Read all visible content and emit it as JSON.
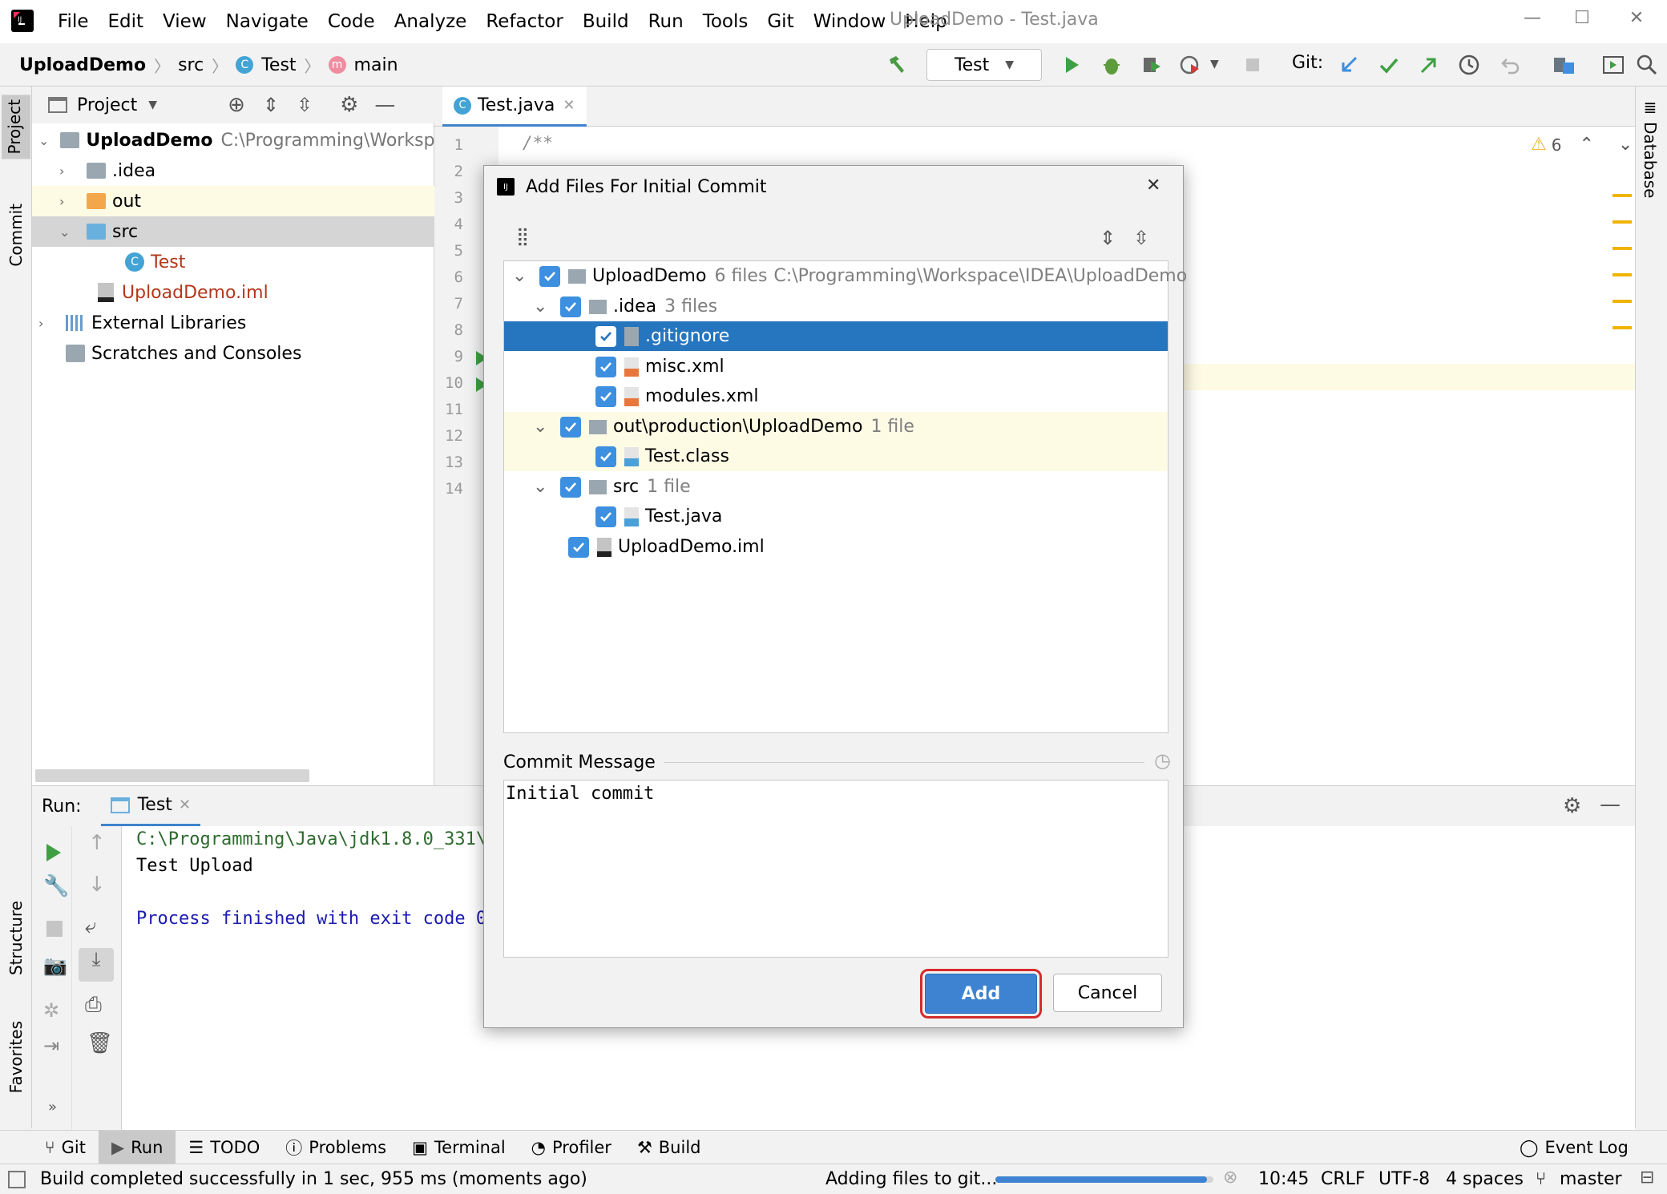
{
  "menu": {
    "items": [
      "File",
      "Edit",
      "View",
      "Navigate",
      "Code",
      "Analyze",
      "Refactor",
      "Build",
      "Run",
      "Tools",
      "Git",
      "Window",
      "Help"
    ],
    "window_title": "UploadDemo - Test.java"
  },
  "navbar": {
    "breadcrumb": [
      "UploadDemo",
      "src",
      "Test",
      "main"
    ],
    "run_config": "Test",
    "git_label": "Git:"
  },
  "left_stripe": {
    "project": "Project",
    "commit": "Commit",
    "structure": "Structure",
    "favorites": "Favorites"
  },
  "right_stripe": {
    "database": "Database"
  },
  "project_panel": {
    "title": "Project",
    "tree": [
      {
        "label": "UploadDemo",
        "extra": "C:\\Programming\\Workspace"
      },
      {
        "label": ".idea"
      },
      {
        "label": "out"
      },
      {
        "label": "src"
      },
      {
        "label": "Test"
      },
      {
        "label": "UploadDemo.iml"
      },
      {
        "label": "External Libraries"
      },
      {
        "label": "Scratches and Consoles"
      }
    ]
  },
  "editor": {
    "tab": "Test.java",
    "line_numbers": [
      "1",
      "2",
      "3",
      "4",
      "5",
      "6",
      "7",
      "8",
      "9",
      "10",
      "11",
      "12",
      "13",
      "14"
    ],
    "code_line1": "/**",
    "warnings": "6"
  },
  "run_panel": {
    "label": "Run:",
    "tab": "Test",
    "console": {
      "cmd": "C:\\Programming\\Java\\jdk1.8.0_331\\",
      "output": "Test Upload",
      "exit": "Process finished with exit code 0"
    }
  },
  "dialog": {
    "title": "Add Files For Initial Commit",
    "files": [
      {
        "name": "UploadDemo",
        "count": "6 files",
        "path": "C:\\Programming\\Workspace\\IDEA\\UploadDemo"
      },
      {
        "name": ".idea",
        "count": "3 files"
      },
      {
        "name": ".gitignore"
      },
      {
        "name": "misc.xml"
      },
      {
        "name": "modules.xml"
      },
      {
        "name": "out\\production\\UploadDemo",
        "count": "1 file"
      },
      {
        "name": "Test.class"
      },
      {
        "name": "src",
        "count": "1 file"
      },
      {
        "name": "Test.java"
      },
      {
        "name": "UploadDemo.iml"
      }
    ],
    "commit_label": "Commit Message",
    "commit_message": "Initial commit",
    "add_button": "Add",
    "cancel_button": "Cancel"
  },
  "bottom_tabs": [
    "Git",
    "Run",
    "TODO",
    "Problems",
    "Terminal",
    "Profiler",
    "Build"
  ],
  "event_log": "Event Log",
  "status": {
    "message": "Build completed successfully in 1 sec, 955 ms (moments ago)",
    "progress_text": "Adding files to git...",
    "progress_value": 0.97,
    "time": "10:45",
    "line_sep": "CRLF",
    "encoding": "UTF-8",
    "indent": "4 spaces",
    "branch": "master"
  },
  "colors": {
    "accent": "#3d83d1",
    "selection": "#2675bf",
    "highlight": "#fefbe5",
    "annotation": "#d62b2b"
  }
}
